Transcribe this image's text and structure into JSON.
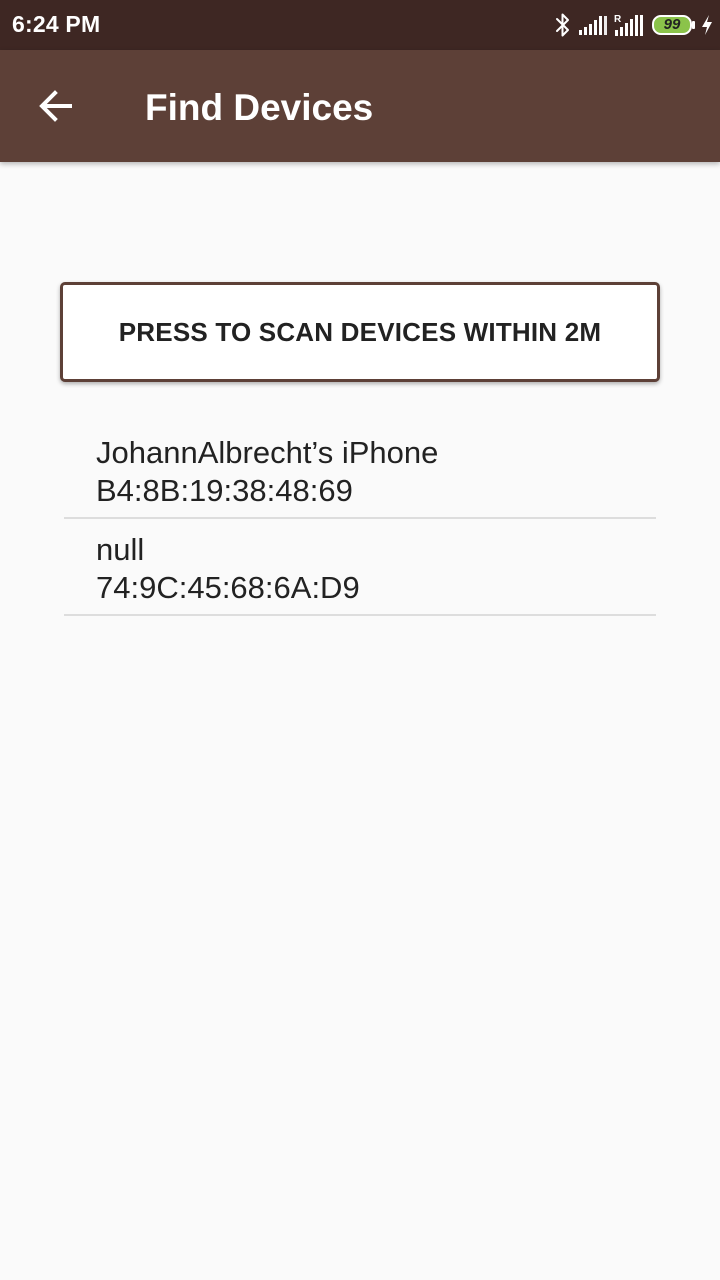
{
  "status_bar": {
    "time": "6:24 PM",
    "battery_level": "99",
    "icons": [
      "bluetooth-icon",
      "signal-icon",
      "roaming-signal-icon",
      "battery-icon",
      "charging-icon"
    ],
    "battery_color": "#8bc34a"
  },
  "app_bar": {
    "title": "Find Devices",
    "back_icon": "back-arrow-icon",
    "background_color": "#5d4037"
  },
  "scan_button": {
    "label": "PRESS TO SCAN DEVICES WITHIN 2M"
  },
  "devices": [
    {
      "name": "JohannAlbrecht’s iPhone",
      "mac": "B4:8B:19:38:48:69"
    },
    {
      "name": "null",
      "mac": "74:9C:45:68:6A:D9"
    }
  ]
}
